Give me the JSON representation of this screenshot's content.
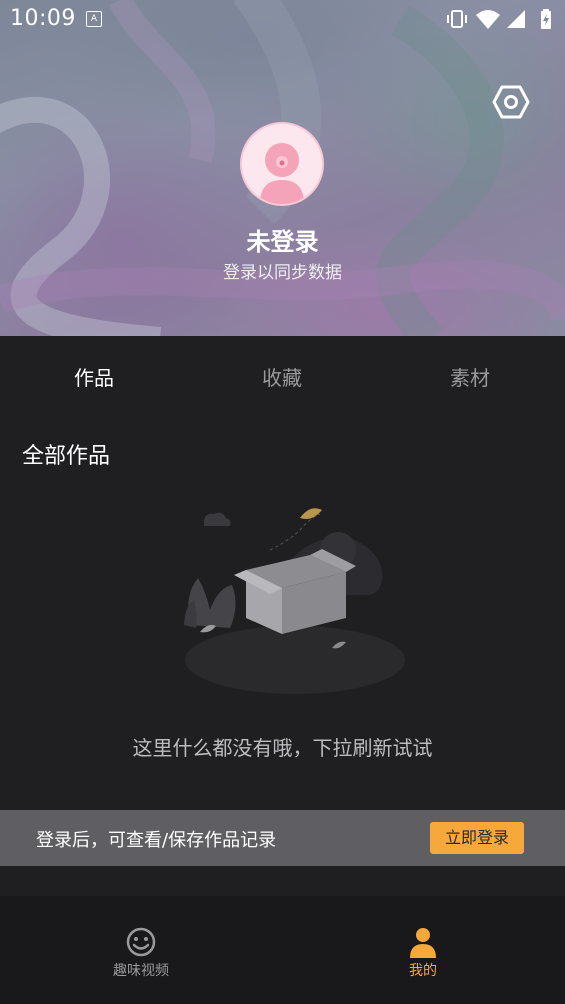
{
  "status_bar": {
    "time": "10:09",
    "notification_icon_letter": "A",
    "icons": [
      "vibrate-icon",
      "wifi-icon",
      "signal-icon",
      "battery-charging-icon"
    ]
  },
  "profile": {
    "username": "未登录",
    "subtitle": "登录以同步数据",
    "settings_icon": "hexagon-settings-icon"
  },
  "tabs": [
    {
      "label": "作品",
      "active": true
    },
    {
      "label": "收藏",
      "active": false
    },
    {
      "label": "素材",
      "active": false
    }
  ],
  "section_title": "全部作品",
  "empty_state": {
    "message": "这里什么都没有哦，下拉刷新试试",
    "illustration": "empty-box-illustration"
  },
  "login_prompt": {
    "text": "登录后，可查看/保存作品记录",
    "button_label": "立即登录"
  },
  "bottom_nav": [
    {
      "label": "趣味视频",
      "icon": "smiley-icon",
      "active": false
    },
    {
      "label": "我的",
      "icon": "person-icon",
      "active": true
    }
  ],
  "colors": {
    "accent": "#f7a83a",
    "background": "#1f1f22",
    "login_bar": "#5f5f63"
  }
}
